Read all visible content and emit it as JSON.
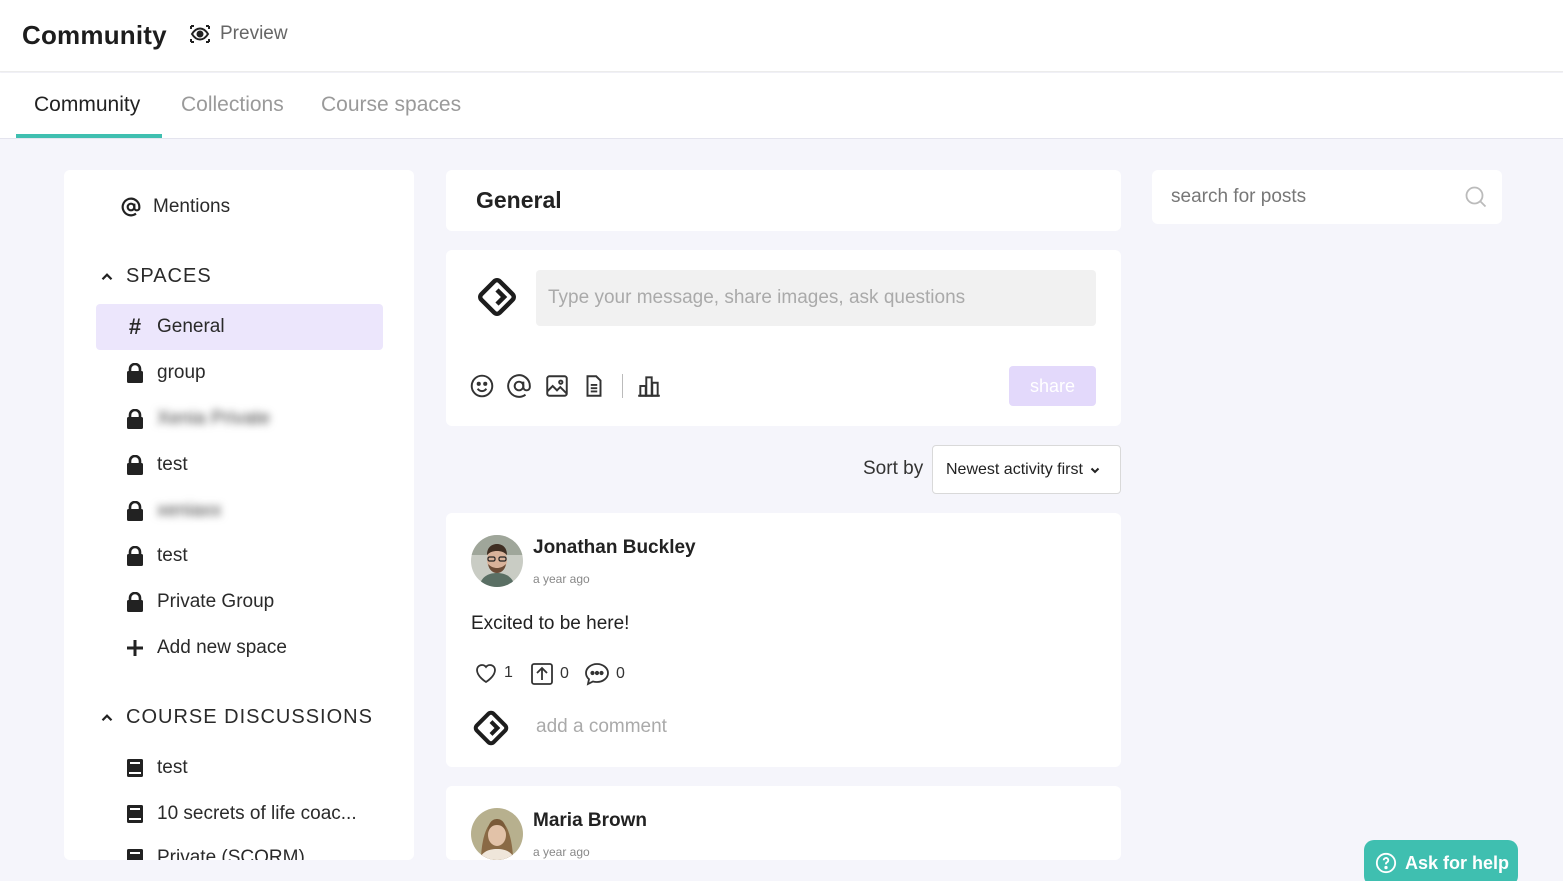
{
  "header": {
    "title": "Community",
    "preview_label": "Preview"
  },
  "tabs": [
    {
      "label": "Community",
      "active": true
    },
    {
      "label": "Collections",
      "active": false
    },
    {
      "label": "Course spaces",
      "active": false
    }
  ],
  "sidebar": {
    "mentions_label": "Mentions",
    "spaces_heading": "SPACES",
    "spaces": [
      {
        "label": "General",
        "icon": "hash-icon",
        "selected": true
      },
      {
        "label": "group",
        "icon": "lock-icon"
      },
      {
        "label": "Xenia Private",
        "icon": "lock-icon",
        "blurred": true
      },
      {
        "label": "test",
        "icon": "lock-icon"
      },
      {
        "label": "xeniaxx",
        "icon": "lock-icon",
        "blurred": true
      },
      {
        "label": "test",
        "icon": "lock-icon"
      },
      {
        "label": "Private Group",
        "icon": "lock-icon"
      }
    ],
    "add_space_label": "Add new space",
    "course_heading": "COURSE DISCUSSIONS",
    "courses": [
      {
        "label": "test",
        "icon": "book-icon"
      },
      {
        "label": "10 secrets of life coac...",
        "icon": "book-icon"
      },
      {
        "label": "Private (SCORM)",
        "icon": "book-icon"
      }
    ]
  },
  "space": {
    "title": "General"
  },
  "composer": {
    "placeholder": "Type your message, share images, ask questions",
    "share_label": "share",
    "tools": [
      "emoji-icon",
      "mention-icon",
      "image-icon",
      "document-icon",
      "poll-icon"
    ]
  },
  "sort": {
    "label": "Sort by",
    "selected": "Newest activity first"
  },
  "posts": [
    {
      "author": "Jonathan Buckley",
      "time": "a year ago",
      "body": "Excited to be here!",
      "likes": "1",
      "shares": "0",
      "comments": "0",
      "comment_placeholder": "add a comment"
    },
    {
      "author": "Maria Brown",
      "time": "a year ago"
    }
  ],
  "search": {
    "placeholder": "search for posts"
  },
  "help": {
    "label": "Ask for help"
  },
  "colors": {
    "accent": "#3fbfb0",
    "selected_space": "#ece6fc",
    "share_button": "#e3d9fb",
    "page_bg": "#f5f5fb"
  }
}
